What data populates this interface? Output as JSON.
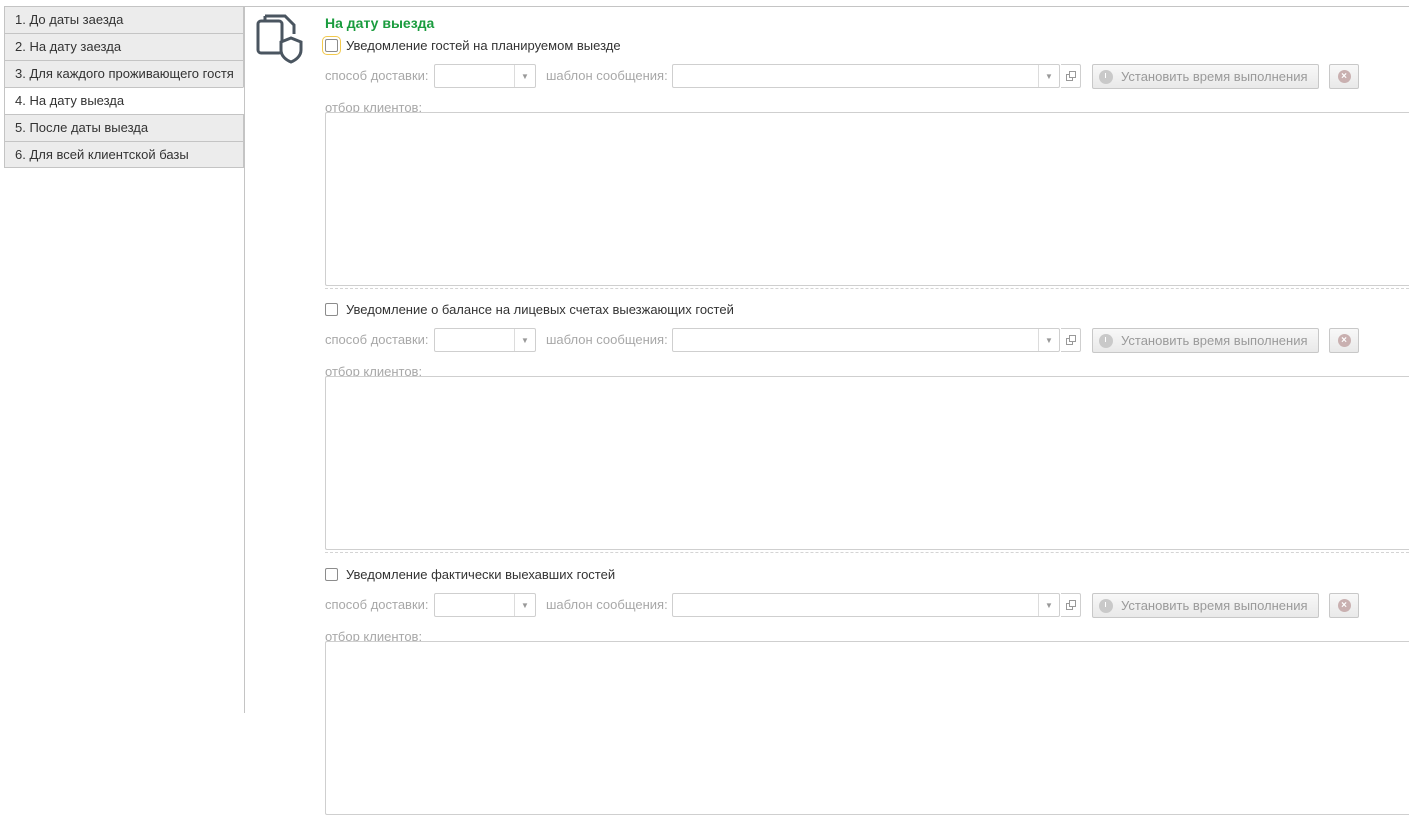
{
  "tabs": [
    {
      "label": "1. До даты заезда",
      "active": false
    },
    {
      "label": "2. На дату заезда",
      "active": false
    },
    {
      "label": "3. Для каждого проживающего гостя",
      "active": false
    },
    {
      "label": "4. На дату выезда",
      "active": true
    },
    {
      "label": "5. После даты выезда",
      "active": false
    },
    {
      "label": "6. Для всей клиентской базы",
      "active": false
    }
  ],
  "page": {
    "title": "На дату выезда",
    "icon": "documents-shield-icon",
    "accent_color": "#1a9c3e"
  },
  "sections": [
    {
      "checkbox_label": "Уведомление гостей на планируемом выезде",
      "checked": false,
      "delivery_label": "способ доставки:",
      "delivery_value": "",
      "template_label": "шаблон сообщения:",
      "template_value": "",
      "time_button": "Установить время выполнения",
      "filter_label": "отбор клиентов:"
    },
    {
      "checkbox_label": "Уведомление о балансе на лицевых счетах выезжающих гостей",
      "checked": false,
      "delivery_label": "способ доставки:",
      "delivery_value": "",
      "template_label": "шаблон сообщения:",
      "template_value": "",
      "time_button": "Установить время выполнения",
      "filter_label": "отбор клиентов:"
    },
    {
      "checkbox_label": "Уведомление фактически выехавших гостей",
      "checked": false,
      "delivery_label": "способ доставки:",
      "delivery_value": "",
      "template_label": "шаблон сообщения:",
      "template_value": "",
      "time_button": "Установить время выполнения",
      "filter_label": "отбор клиентов:"
    }
  ]
}
